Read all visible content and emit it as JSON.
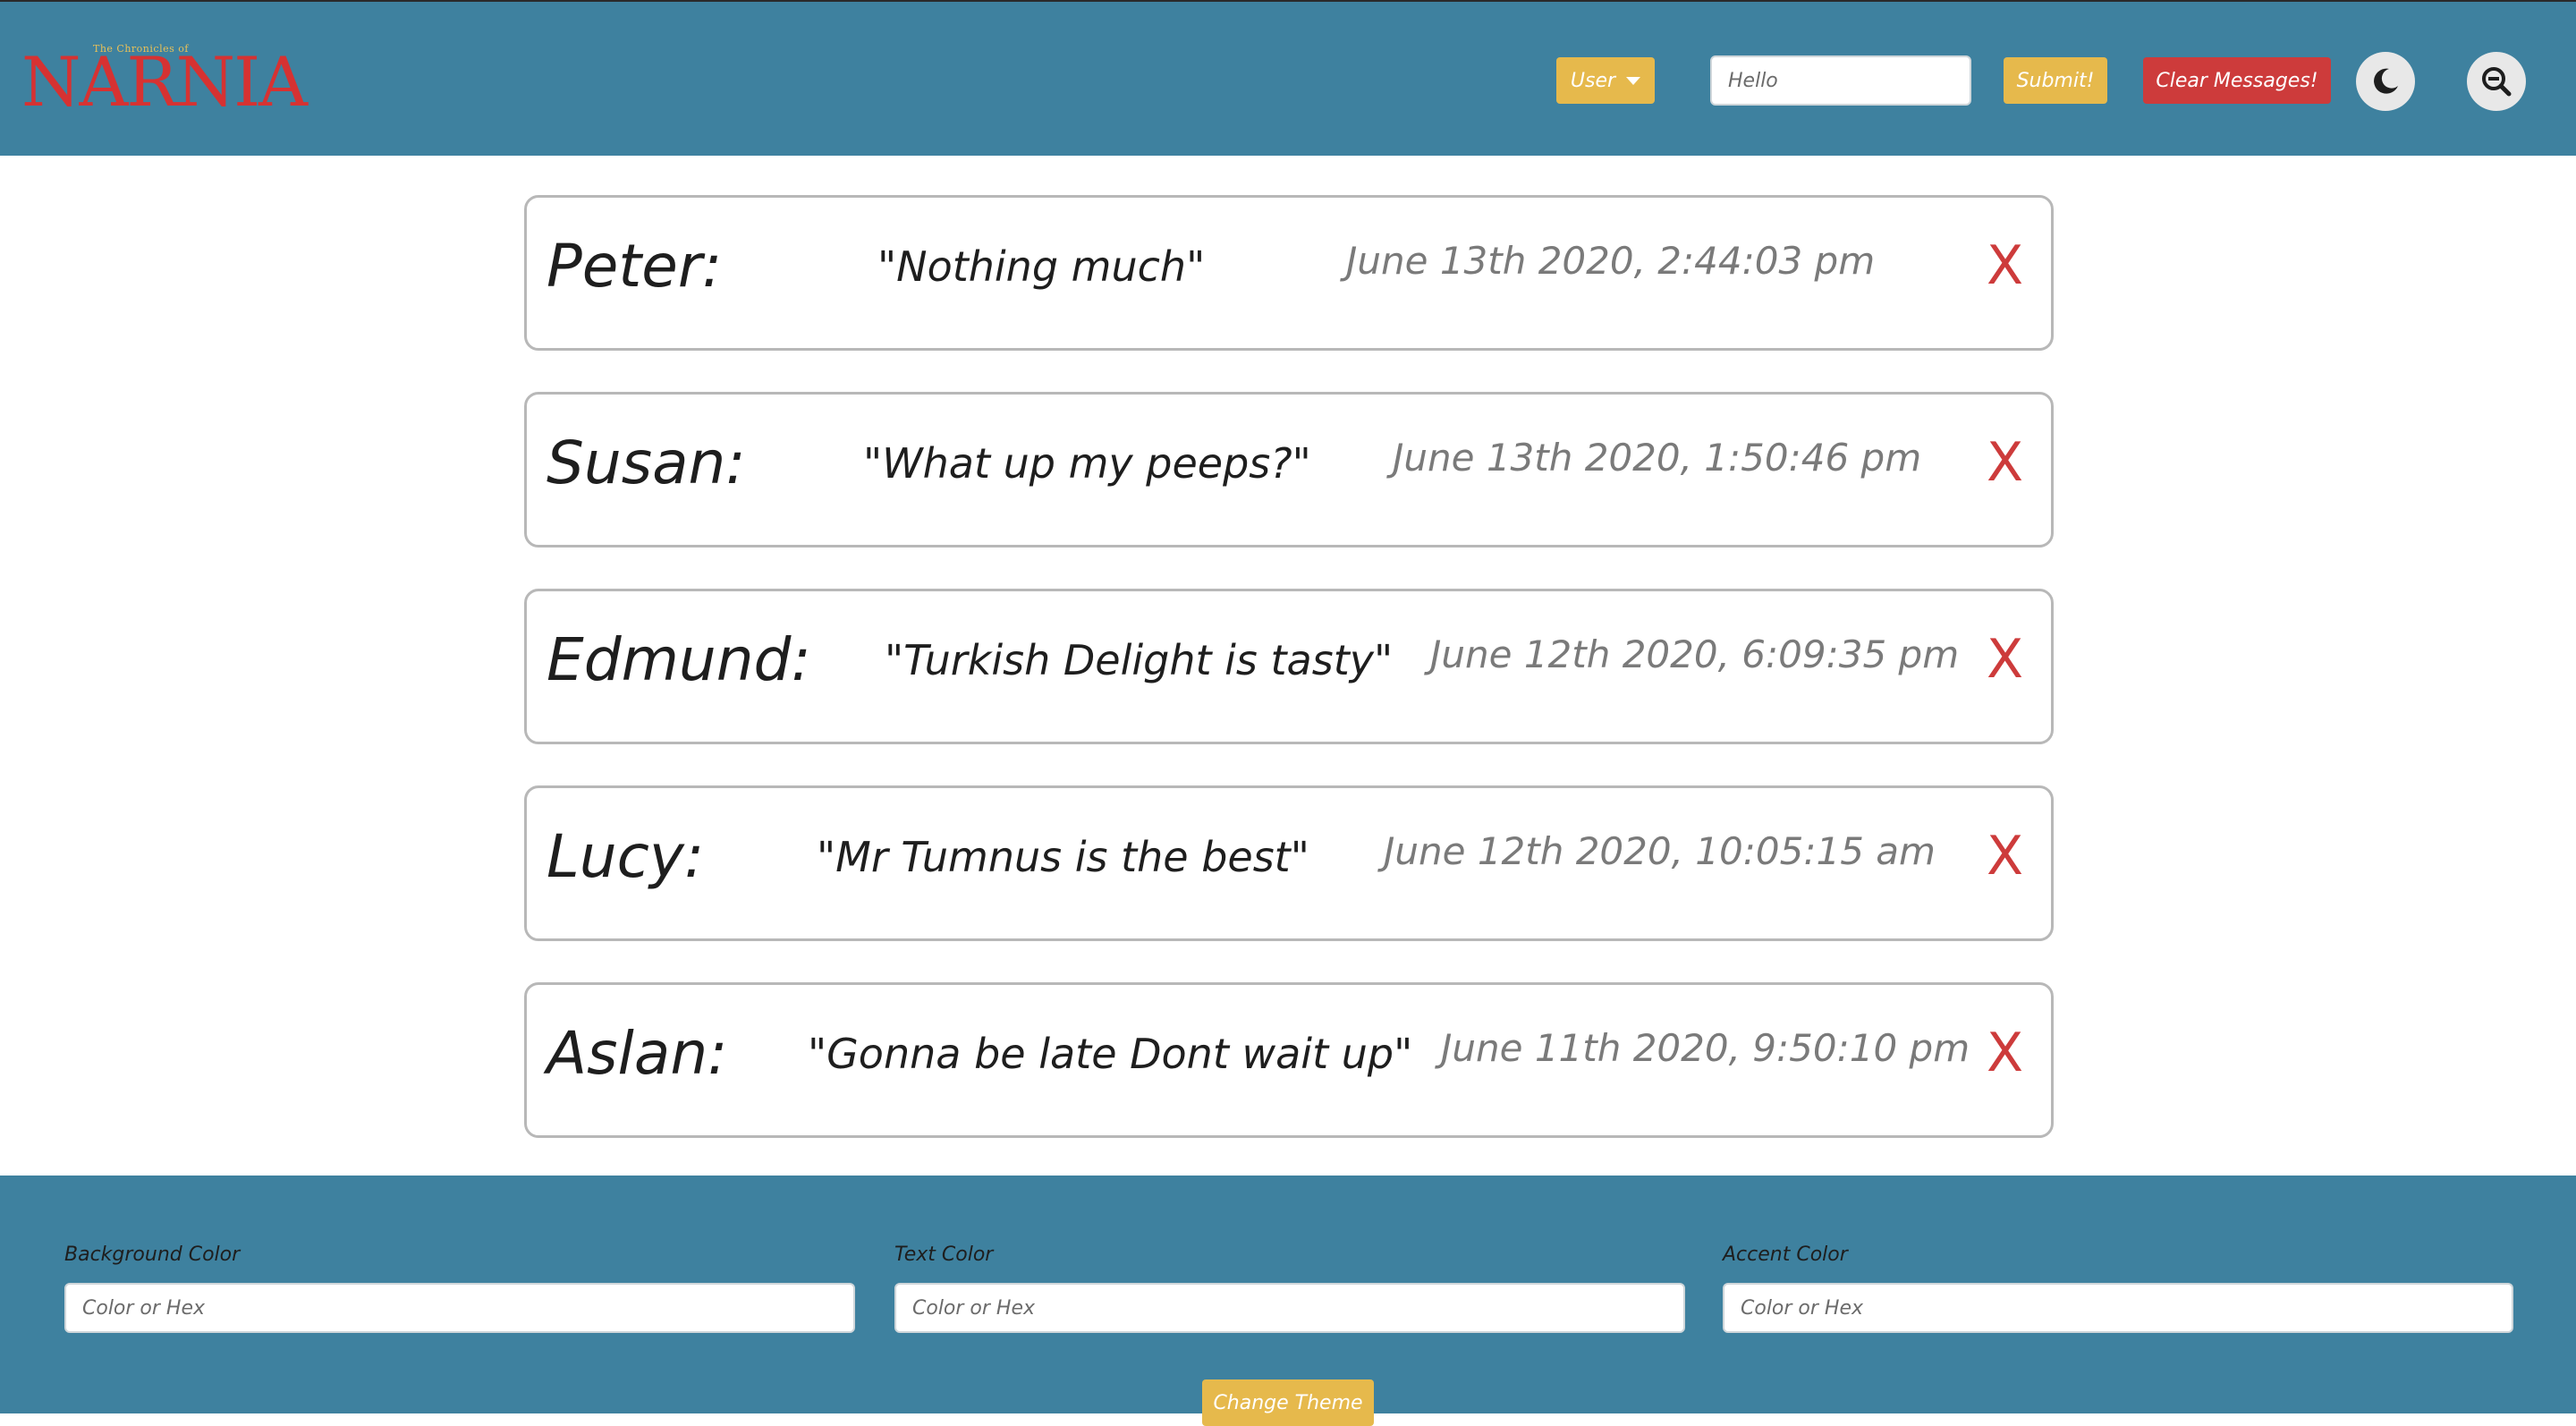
{
  "header": {
    "logo_small": "The Chronicles of",
    "logo_big": "NARNIA",
    "user_button": "User",
    "message_input": {
      "value": "",
      "placeholder": "Hello"
    },
    "submit_button": "Submit!",
    "clear_button": "Clear Messages!",
    "dark_mode_icon": "moon-icon",
    "zoom_icon": "zoom-out-icon"
  },
  "messages": [
    {
      "name": "Peter:",
      "text": "\"Nothing much\"",
      "time": "June 13th 2020, 2:44:03 pm",
      "delete": "X"
    },
    {
      "name": "Susan:",
      "text": "\"What up my peeps?\"",
      "time": "June 13th 2020, 1:50:46 pm",
      "delete": "X"
    },
    {
      "name": "Edmund:",
      "text": "\"Turkish Delight is tasty\"",
      "time": "June 12th 2020, 6:09:35 pm",
      "delete": "X"
    },
    {
      "name": "Lucy:",
      "text": "\"Mr Tumnus is the best\"",
      "time": "June 12th 2020, 10:05:15 am",
      "delete": "X"
    },
    {
      "name": "Aslan:",
      "text": "\"Gonna be late Dont wait up\"",
      "time": "June 11th 2020, 9:50:10 pm",
      "delete": "X"
    }
  ],
  "footer": {
    "background_label": "Background Color",
    "background_placeholder": "Color or Hex",
    "text_label": "Text Color",
    "text_placeholder": "Color or Hex",
    "accent_label": "Accent Color",
    "accent_placeholder": "Color or Hex",
    "change_theme_button": "Change Theme"
  },
  "colors": {
    "primary": "#3e819f",
    "accent_yellow": "#e6b94c",
    "danger_red": "#cd3b3b"
  }
}
